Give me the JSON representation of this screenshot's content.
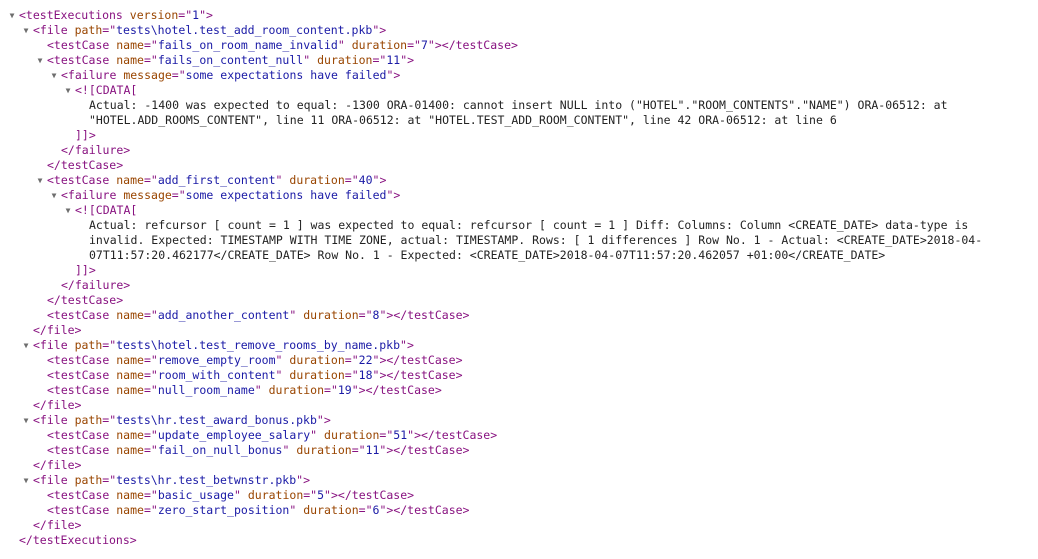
{
  "root": {
    "tag": "testExecutions",
    "attrs": [
      {
        "name": "version",
        "value": "1"
      }
    ],
    "files": [
      {
        "path": "tests\\hotel.test_add_room_content.pkb",
        "testCases": [
          {
            "name": "fails_on_room_name_invalid",
            "duration": "7"
          },
          {
            "name": "fails_on_content_null",
            "duration": "11",
            "failure": {
              "message": "some expectations have failed",
              "cdata": "Actual: -1400 was expected to equal: -1300 ORA-01400: cannot insert NULL into (\"HOTEL\".\"ROOM_CONTENTS\".\"NAME\") ORA-06512: at \"HOTEL.ADD_ROOMS_CONTENT\", line 11 ORA-06512: at \"HOTEL.TEST_ADD_ROOM_CONTENT\", line 42 ORA-06512: at line 6"
            }
          },
          {
            "name": "add_first_content",
            "duration": "40",
            "failure": {
              "message": "some expectations have failed",
              "cdata": "Actual: refcursor [ count = 1 ] was expected to equal: refcursor [ count = 1 ] Diff: Columns: Column <CREATE_DATE> data-type is invalid. Expected: TIMESTAMP WITH TIME ZONE, actual: TIMESTAMP. Rows: [ 1 differences ] Row No. 1 - Actual: <CREATE_DATE>2018-04-07T11:57:20.462177</CREATE_DATE> Row No. 1 - Expected: <CREATE_DATE>2018-04-07T11:57:20.462057 +01:00</CREATE_DATE>"
            }
          },
          {
            "name": "add_another_content",
            "duration": "8"
          }
        ]
      },
      {
        "path": "tests\\hotel.test_remove_rooms_by_name.pkb",
        "testCases": [
          {
            "name": "remove_empty_room",
            "duration": "22"
          },
          {
            "name": "room_with_content",
            "duration": "18"
          },
          {
            "name": "null_room_name",
            "duration": "19"
          }
        ]
      },
      {
        "path": "tests\\hr.test_award_bonus.pkb",
        "testCases": [
          {
            "name": "update_employee_salary",
            "duration": "51"
          },
          {
            "name": "fail_on_null_bonus",
            "duration": "11"
          }
        ]
      },
      {
        "path": "tests\\hr.test_betwnstr.pkb",
        "testCases": [
          {
            "name": "basic_usage",
            "duration": "5"
          },
          {
            "name": "zero_start_position",
            "duration": "6"
          }
        ]
      }
    ]
  },
  "icons": {
    "expanded": "▼"
  }
}
